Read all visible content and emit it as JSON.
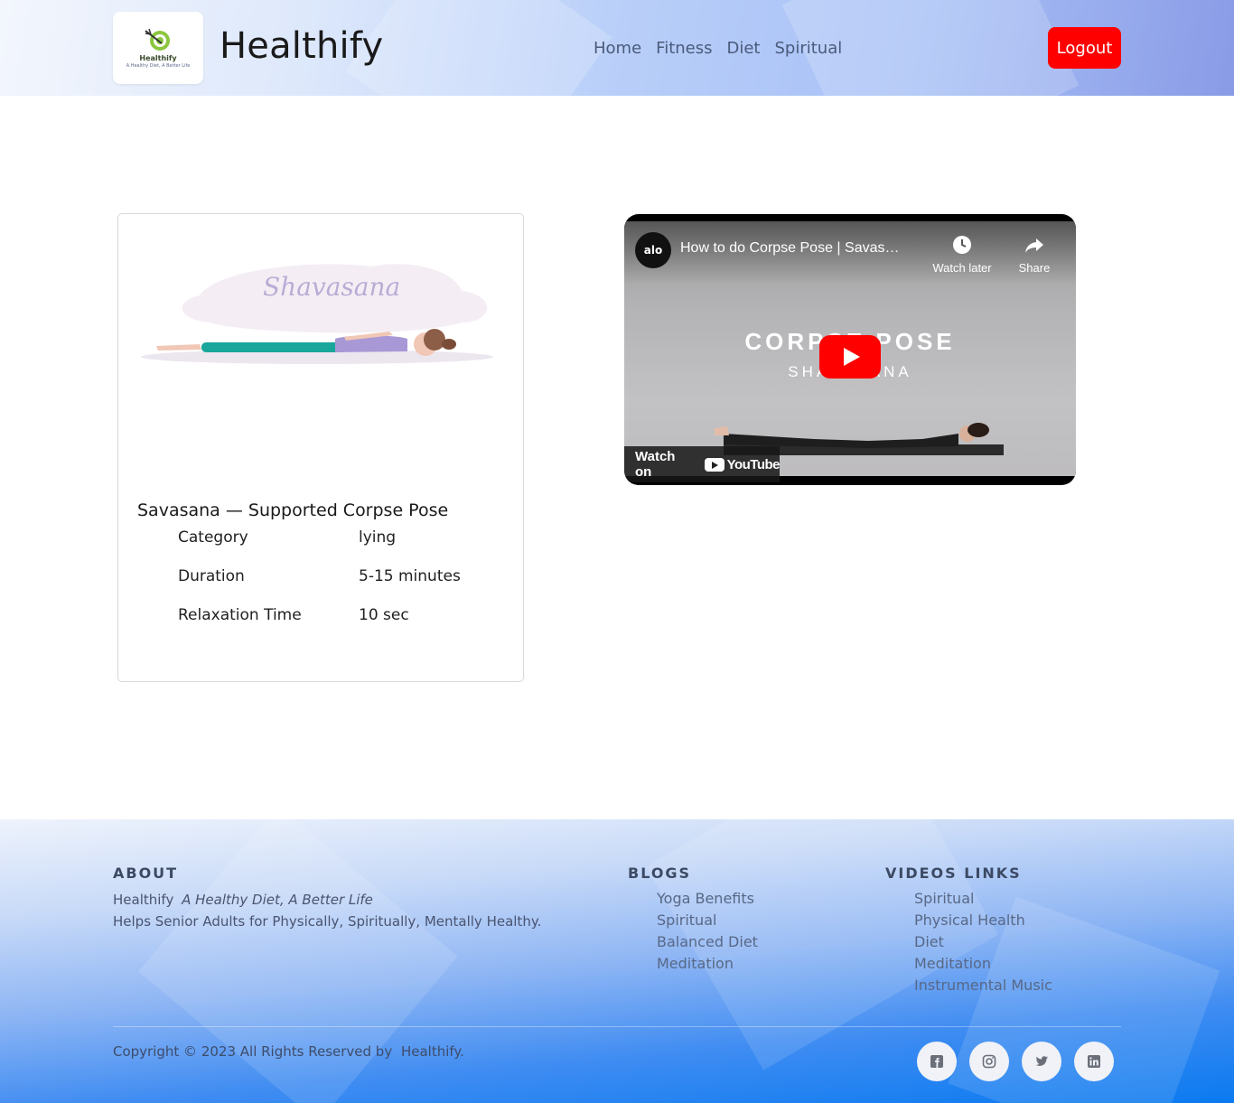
{
  "header": {
    "logo": {
      "brand": "Healthify",
      "tagline": "A Healthy Diet, A Better Life"
    },
    "site_name": "Healthify",
    "nav": [
      "Home",
      "Fitness",
      "Diet",
      "Spiritual"
    ],
    "logout_label": "Logout"
  },
  "pose_card": {
    "illustration_label": "Shavasana",
    "title": "Savasana — Supported Corpse Pose",
    "rows": [
      {
        "label": "Category",
        "value": "lying"
      },
      {
        "label": "Duration",
        "value": "5-15 minutes"
      },
      {
        "label": "Relaxation Time",
        "value": "10 sec"
      }
    ]
  },
  "video": {
    "channel_avatar_text": "alo",
    "title": "How to do Corpse Pose | Savas…",
    "watch_later_label": "Watch later",
    "share_label": "Share",
    "overlay_heading": "CORPSE POSE",
    "overlay_sub": "SHAVASANA",
    "watch_on_label": "Watch on",
    "youtube_wordmark": "YouTube"
  },
  "footer": {
    "about": {
      "heading": "ABOUT",
      "brand": "Healthify",
      "tagline": "A Healthy Diet, A Better Life",
      "description": "Helps Senior Adults for Physically, Spiritually, Mentally Healthy."
    },
    "blogs": {
      "heading": "BLOGS",
      "items": [
        "Yoga Benefits",
        "Spiritual",
        "Balanced Diet",
        "Meditation"
      ]
    },
    "videos": {
      "heading": "VIDEOS LINKS",
      "items": [
        "Spiritual",
        "Physical Health",
        "Diet",
        "Meditation",
        "Instrumental Music"
      ]
    },
    "copyright_text": "Copyright © 2023 All Rights Reserved by",
    "copyright_brand": "Healthify.",
    "social_icons": [
      "facebook-icon",
      "instagram-icon",
      "twitter-icon",
      "linkedin-icon"
    ]
  },
  "colors": {
    "logout_bg": "#ff0000",
    "youtube_red": "#ff0000",
    "pose_teal": "#1aa69b",
    "pose_lavender": "#a998d6"
  }
}
